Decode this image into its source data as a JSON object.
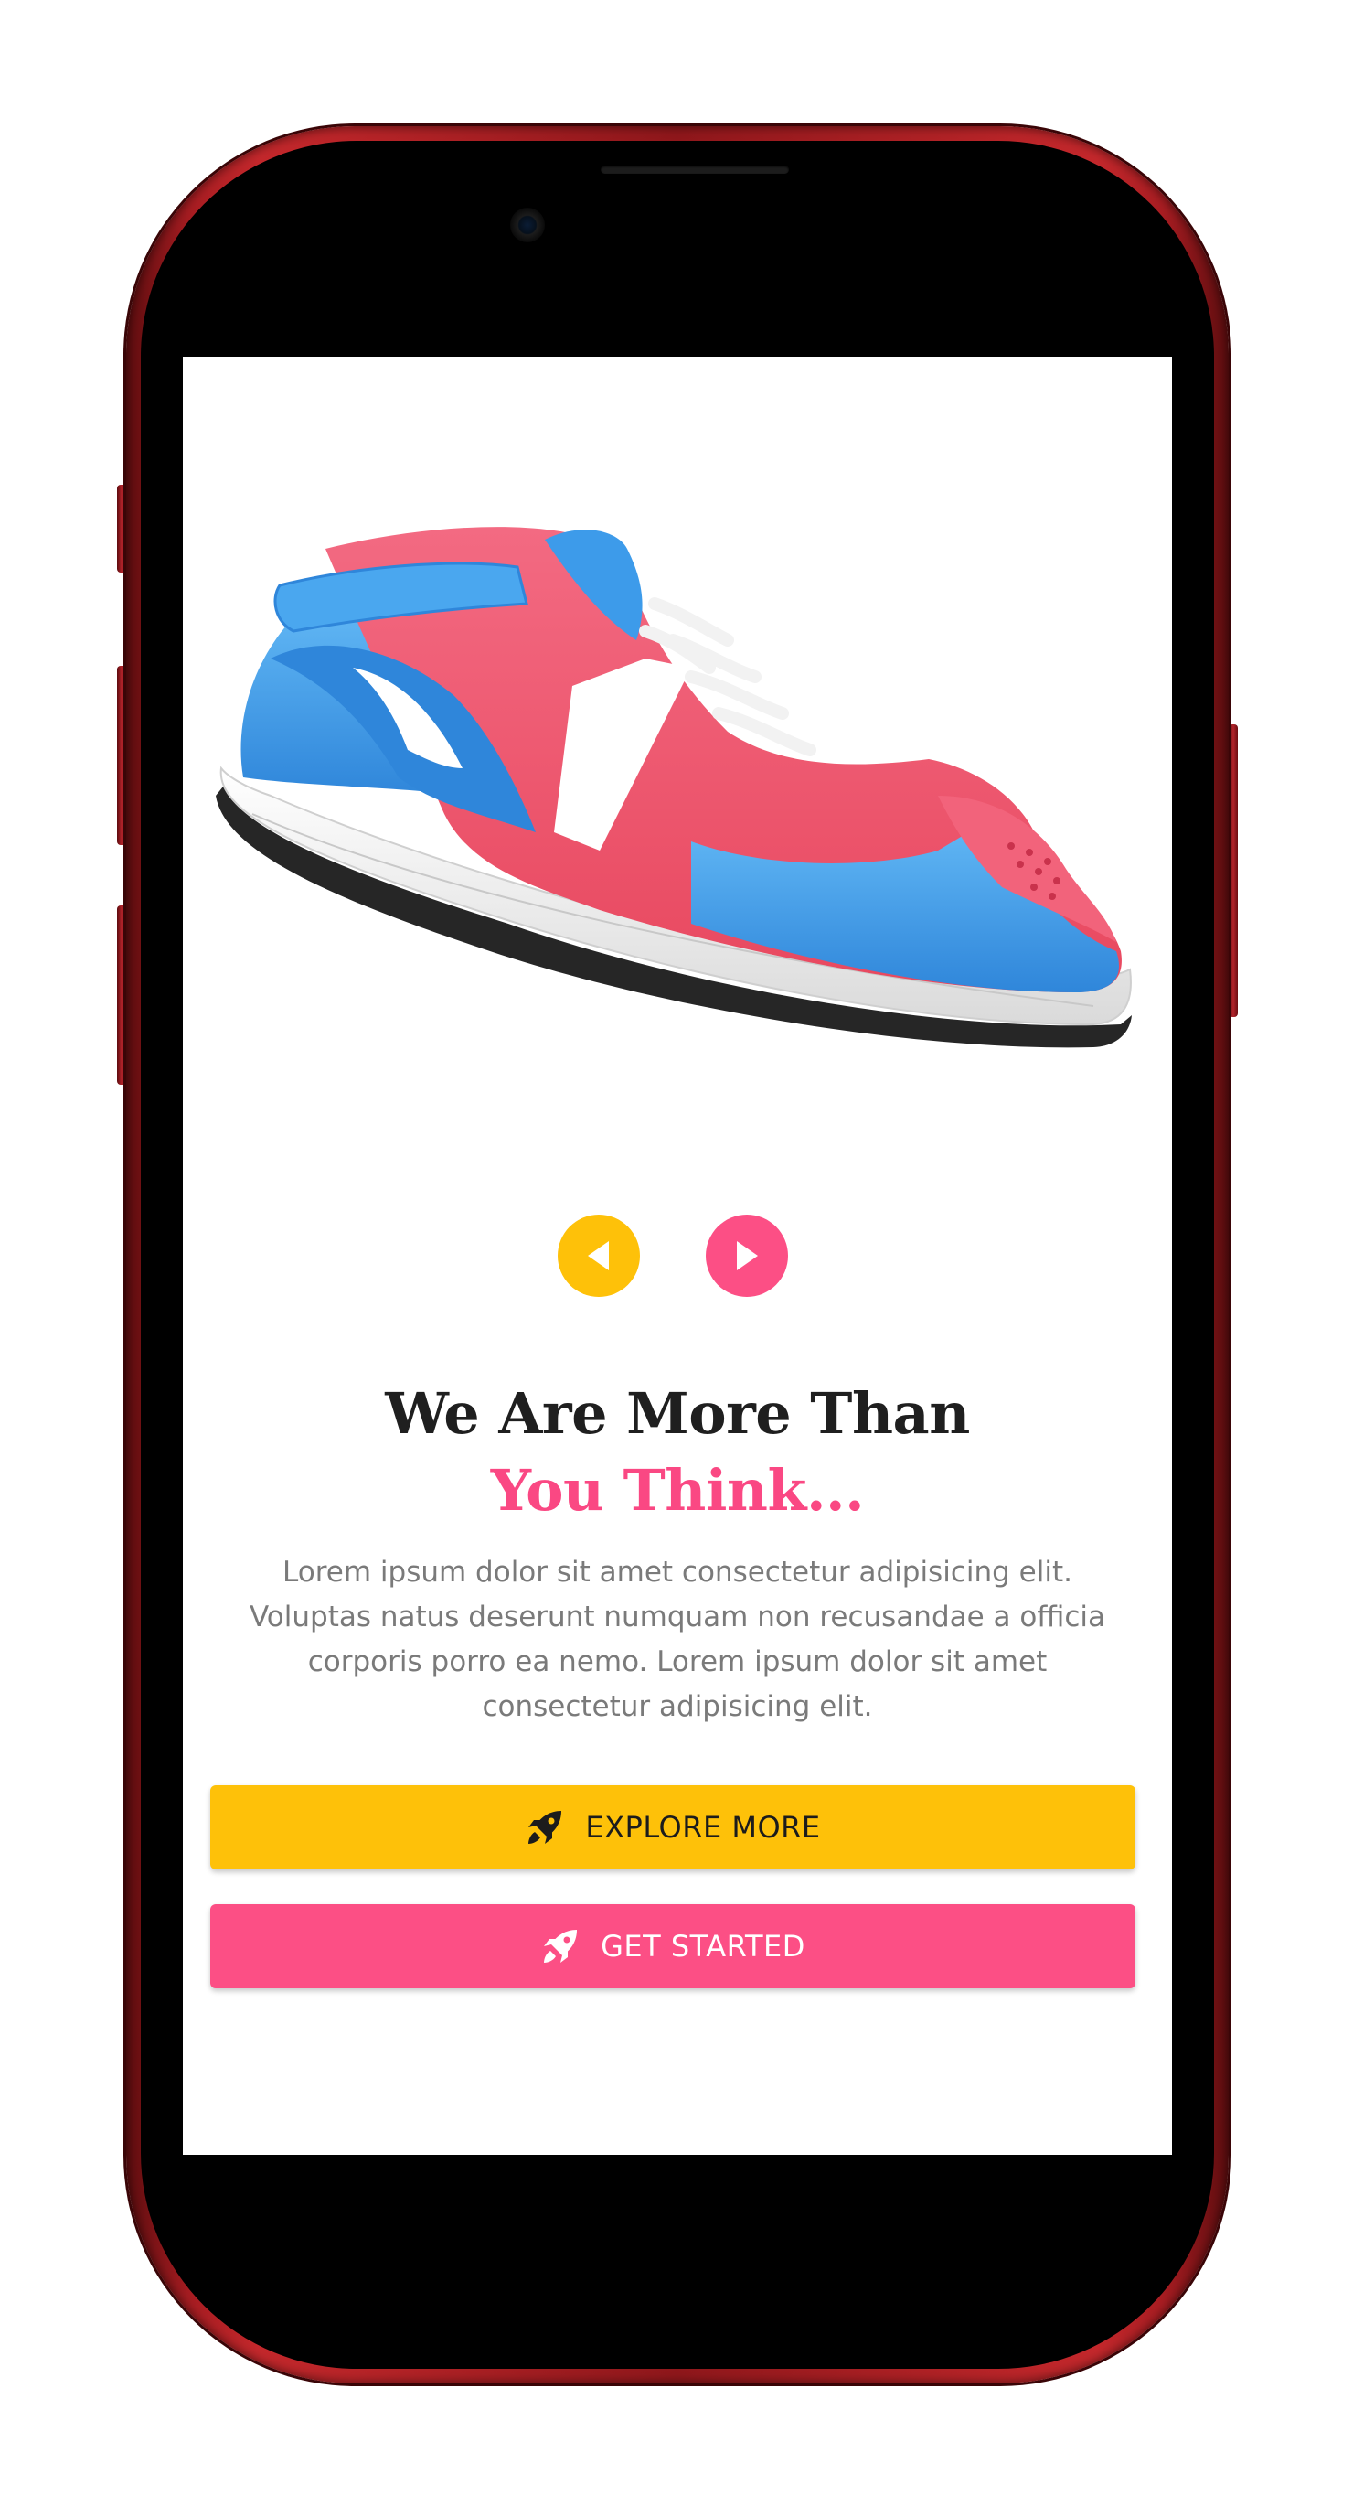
{
  "hero": {
    "image": "sneaker-illustration",
    "colors": {
      "blue": "#3d9bea",
      "pink": "#f05670",
      "white": "#ffffff",
      "sole": "#2a2a2a"
    }
  },
  "carousel": {
    "prev_icon": "caret-left-icon",
    "next_icon": "caret-right-icon",
    "prev_color": "#fec109",
    "next_color": "#fc4f85"
  },
  "headline": {
    "line1": "We Are More Than",
    "line2": "You Think..."
  },
  "description": "Lorem ipsum dolor sit amet consectetur adipisicing elit. Voluptas natus deserunt numquam non recusandae a officia corporis porro ea nemo. Lorem ipsum dolor sit amet consectetur adipisicing elit.",
  "buttons": {
    "explore": {
      "label": "EXPLORE MORE",
      "icon": "rocket-icon",
      "color": "#fec109"
    },
    "start": {
      "label": "GET STARTED",
      "icon": "rocket-icon",
      "color": "#fc4f85"
    }
  }
}
